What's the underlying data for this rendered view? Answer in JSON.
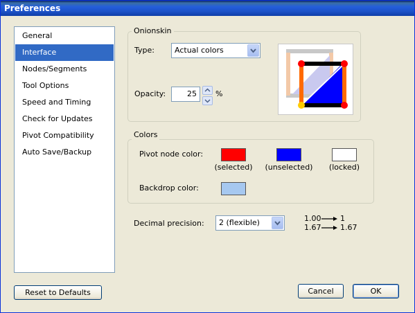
{
  "window": {
    "title": "Preferences"
  },
  "nav": {
    "items": [
      {
        "label": "General"
      },
      {
        "label": "Interface",
        "selected": true
      },
      {
        "label": "Nodes/Segments"
      },
      {
        "label": "Tool Options"
      },
      {
        "label": "Speed and Timing"
      },
      {
        "label": "Check for Updates"
      },
      {
        "label": "Pivot Compatibility"
      },
      {
        "label": "Auto Save/Backup"
      }
    ]
  },
  "onionskin": {
    "group_label": "Onionskin",
    "type_label": "Type:",
    "type_value": "Actual colors",
    "opacity_label": "Opacity:",
    "opacity_value": "25",
    "opacity_unit": "%"
  },
  "colors": {
    "group_label": "Colors",
    "pivot_label": "Pivot node color:",
    "selected_caption": "(selected)",
    "unselected_caption": "(unselected)",
    "locked_caption": "(locked)",
    "backdrop_label": "Backdrop color:",
    "selected_color": "#ff0000",
    "unselected_color": "#0000ff",
    "locked_color": "#ffffff",
    "backdrop_color": "#a6c8f0"
  },
  "precision": {
    "label": "Decimal precision:",
    "value": "2 (flexible)",
    "example1_in": "1.00",
    "example1_out": "1",
    "example2_in": "1.67",
    "example2_out": "1.67"
  },
  "buttons": {
    "reset": "Reset to Defaults",
    "cancel": "Cancel",
    "ok": "OK"
  }
}
